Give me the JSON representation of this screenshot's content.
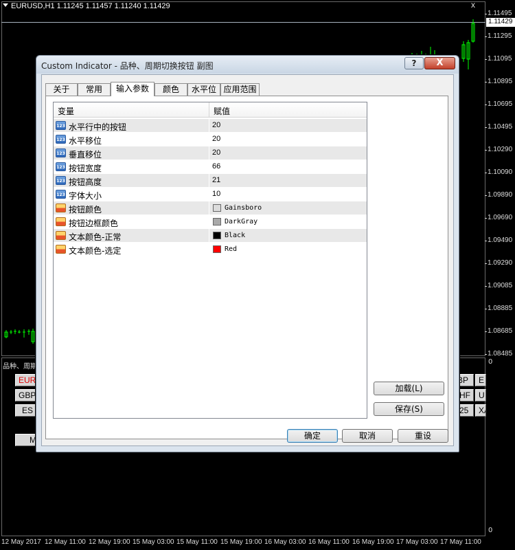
{
  "chart": {
    "symbol_header": "EURUSD,H1  1.11245 1.11457 1.11240 1.11429",
    "close_x": "x",
    "current_price": "1.11429",
    "price_ticks": [
      "1.11495",
      "1.11295",
      "1.11095",
      "1.10895",
      "1.10695",
      "1.10495",
      "1.10290",
      "1.10090",
      "1.09890",
      "1.09690",
      "1.09490",
      "1.09290",
      "1.09085",
      "1.08885",
      "1.08685",
      "1.08485"
    ],
    "sub_window_label": "品种、周期",
    "sub_zero_top": "0",
    "sub_zero_bottom": "0",
    "panel_buttons": [
      {
        "text": "EUR",
        "color": "#e00000"
      },
      {
        "text": "GBP",
        "color": "#000000"
      },
      {
        "text": "ES",
        "color": "#000000"
      },
      {
        "text": "M",
        "color": "#000000"
      },
      {
        "text": "BP",
        "color": "#000000"
      },
      {
        "text": "E",
        "color": "#000000"
      },
      {
        "text": "HF",
        "color": "#000000"
      },
      {
        "text": "U",
        "color": "#000000"
      },
      {
        "text": "25",
        "color": "#000000"
      },
      {
        "text": "XA",
        "color": "#000000"
      }
    ],
    "time_ticks": [
      "12 May 2017",
      "12 May 11:00",
      "12 May 19:00",
      "15 May 03:00",
      "15 May 11:00",
      "15 May 19:00",
      "16 May 03:00",
      "16 May 11:00",
      "16 May 19:00",
      "17 May 03:00",
      "17 May 11:00"
    ]
  },
  "dialog": {
    "title": "Custom Indicator - 品种、周期切换按钮 副图",
    "help_label": "?",
    "close_label": "X",
    "tabs": [
      "关于",
      "常用",
      "输入参数",
      "颜色",
      "水平位",
      "应用范围"
    ],
    "active_tab": "输入参数",
    "grid": {
      "col_variable": "变量",
      "col_value": "赋值",
      "rows": [
        {
          "icon": "123",
          "name": "水平行中的按钮",
          "value": "20"
        },
        {
          "icon": "123",
          "name": "水平移位",
          "value": "20"
        },
        {
          "icon": "123",
          "name": "垂直移位",
          "value": "20"
        },
        {
          "icon": "123",
          "name": "按钮宽度",
          "value": "66"
        },
        {
          "icon": "123",
          "name": "按钮高度",
          "value": "21"
        },
        {
          "icon": "123",
          "name": "字体大小",
          "value": "10"
        },
        {
          "icon": "color",
          "name": "按钮颜色",
          "value": "Gainsboro",
          "swatch": "#dcdcdc"
        },
        {
          "icon": "color",
          "name": "按钮边框颜色",
          "value": "DarkGray",
          "swatch": "#a9a9a9"
        },
        {
          "icon": "color",
          "name": "文本颜色-正常",
          "value": "Black",
          "swatch": "#000000"
        },
        {
          "icon": "color",
          "name": "文本颜色-选定",
          "value": "Red",
          "swatch": "#ff0000"
        }
      ]
    },
    "load_button": "加载(L)",
    "save_button": "保存(S)",
    "ok_button": "确定",
    "cancel_button": "取消",
    "reset_button": "重设"
  }
}
